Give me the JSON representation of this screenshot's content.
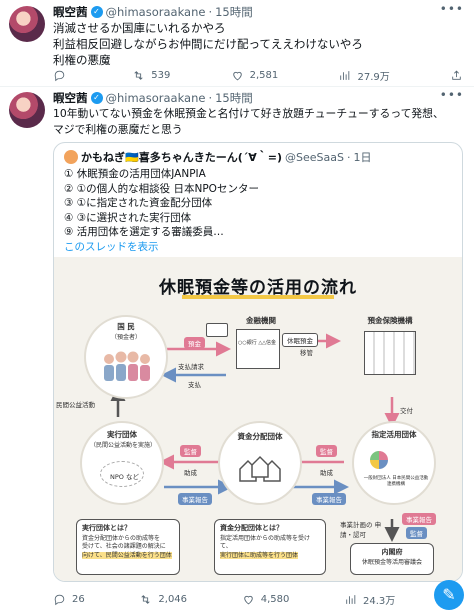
{
  "tweet1": {
    "name": "暇空茜",
    "handle": "@himasoraakane",
    "time": "15時間",
    "lines": [
      "消滅させるか国庫にいれるかやろ",
      "利益相反回避しながらお仲間にだけ配ってええわけないやろ",
      "利権の悪魔"
    ],
    "replies": "",
    "retweets": "539",
    "likes": "2,581",
    "views": "27.9万"
  },
  "tweet2": {
    "name": "暇空茜",
    "handle": "@himasoraakane",
    "time": "15時間",
    "lines": [
      "10年動いてない預金を休眠預金と名付けて好き放題チューチューするって発想、",
      "マジで利権の悪魔だと思う"
    ],
    "replies": "26",
    "retweets": "2,046",
    "likes": "4,580",
    "views": "24.3万"
  },
  "quote": {
    "name": "かもねぎ🇺🇦喜多ちゃんきたーん(´∀｀=)",
    "handle": "@SeeSaaS",
    "time": "1日",
    "lines": [
      "① 休眠預金の活用団体JANPIA",
      "② ①の個人的な相談役 日本NPOセンター",
      "③ ①に指定された資金配分団体",
      "④ ③に選択された実行団体",
      "⑨ 活用団体を選定する審議委員…"
    ],
    "thread_link": "このスレッドを表示"
  },
  "figure": {
    "title": "休眠預金等の活用の流れ",
    "kokumin": "国 民",
    "kokumin_sub": "（預金者）",
    "yokin": "預金",
    "shiharai_seikyu": "支払請求",
    "shiharai": "支払",
    "kinyu": "金融機関",
    "ginko_label": "○○銀行 △△信金",
    "kyumin_yokin": "休眠預金",
    "iko": "移管",
    "hoken": "預金保険機構",
    "kofu": "交付",
    "minkan": "民間公益活動",
    "jikko": "実行団体",
    "jikko_sub": "（民間公益活動を実施）",
    "npo": "NPO など",
    "kantoku1": "監督",
    "josei1": "助成",
    "jigyo_hokoku1": "事業報告",
    "haibun": "資金分配団体",
    "kantoku2": "監督",
    "josei2": "助成",
    "jigyo_hokoku2": "事業報告",
    "shitei": "指定活用団体",
    "janpia": "一般財団法人 日本民間公益活動連携機構",
    "jigyo_keikaku": "事業計画の 申請・認可",
    "jigyo_hokoku3": "事業報告",
    "kantoku3": "監督",
    "naikakufu": "内閣府",
    "shingikai": "休眠預金等活用審議会",
    "box1_title": "実行団体とは？",
    "box1_text1": "資金分配団体からの助成等を",
    "box1_text2": "受けて、社会の諸課題の解決に",
    "box1_text3": "向けて、民間公益活動を行う団体",
    "box2_title": "資金分配団体とは？",
    "box2_text1": "指定活用団体からの助成等を受けて、",
    "box2_text2": "実行団体に助成等を行う団体"
  },
  "colors": {
    "accent": "#1d9bf0",
    "pink": "#e07a94",
    "blue": "#6a8fc2",
    "yellow": "#f3c845"
  },
  "icons": [
    "reply-icon",
    "retweet-icon",
    "like-icon",
    "views-icon",
    "share-icon",
    "verified-icon",
    "more-icon",
    "compose-icon"
  ]
}
